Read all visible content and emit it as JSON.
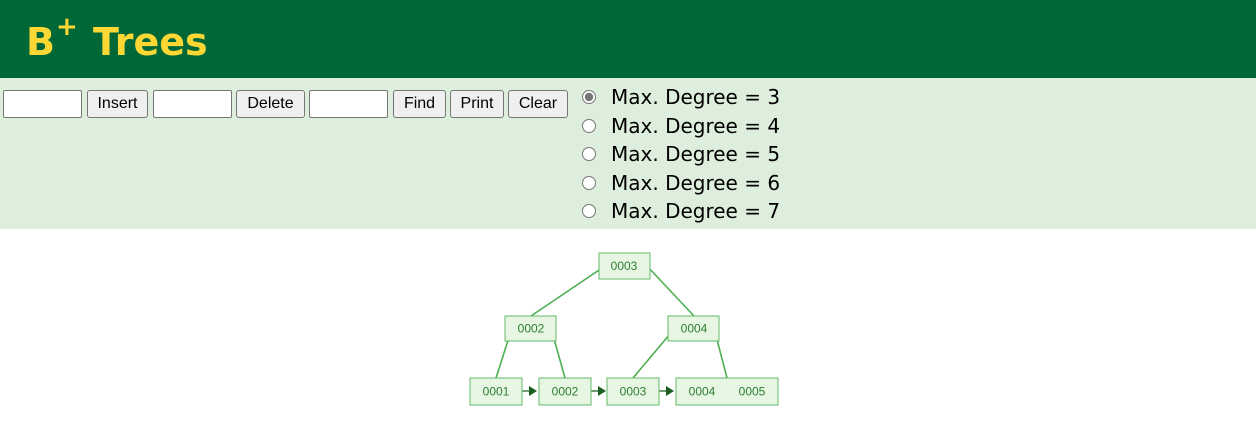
{
  "header": {
    "title_prefix": "B",
    "title_sup": "+",
    "title_rest": " Trees"
  },
  "toolbar": {
    "insert_value": "",
    "insert_label": "Insert",
    "delete_value": "",
    "delete_label": "Delete",
    "find_value": "",
    "find_label": "Find",
    "print_label": "Print",
    "clear_label": "Clear"
  },
  "degree_options": [
    {
      "label": "Max. Degree = 3",
      "checked": true
    },
    {
      "label": "Max. Degree = 4",
      "checked": false
    },
    {
      "label": "Max. Degree = 5",
      "checked": false
    },
    {
      "label": "Max. Degree = 6",
      "checked": false
    },
    {
      "label": "Max. Degree = 7",
      "checked": false
    }
  ],
  "tree": {
    "root": {
      "keys": [
        "0003"
      ]
    },
    "internal": [
      {
        "keys": [
          "0002"
        ]
      },
      {
        "keys": [
          "0004"
        ]
      }
    ],
    "leaves": [
      {
        "keys": [
          "0001"
        ]
      },
      {
        "keys": [
          "0002"
        ]
      },
      {
        "keys": [
          "0003"
        ]
      },
      {
        "keys": [
          "0004",
          "0005"
        ]
      }
    ]
  },
  "colors": {
    "header_bg": "#006837",
    "title": "#fdd835",
    "panel_bg": "#deeedc",
    "node_fill": "#e7f6e2",
    "node_stroke": "#66bb6a",
    "node_text": "#2e7d32",
    "edge": "#4caf50"
  }
}
